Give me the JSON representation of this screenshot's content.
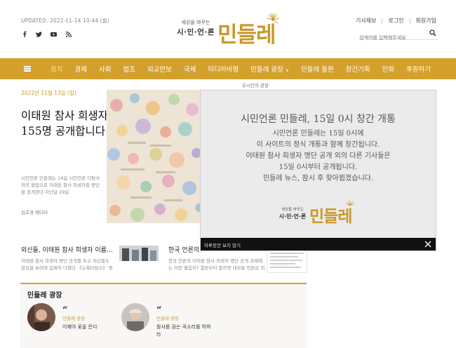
{
  "header": {
    "updated": "UPDATED. 2022-11-14 10:44 (월)",
    "socials": [
      "facebook-icon",
      "twitter-icon",
      "youtube-icon",
      "rss-icon"
    ],
    "logo_sub": "세상을 바꾸는",
    "logo_main": "시·민·언·론",
    "logo_name": "민들레",
    "links": [
      "기사제보",
      "로그인",
      "회원가입"
    ],
    "search_placeholder": "검색어를 입력해주세요"
  },
  "nav": {
    "items": [
      "정치",
      "경제",
      "사회",
      "법조",
      "외교안보",
      "국제",
      "미디어비평",
      "민들레 광장",
      "민들레 들판",
      "창간기획",
      "만화",
      "후원하기"
    ],
    "active_index": 0,
    "sub_label": "유시민의 관찰"
  },
  "main": {
    "date": "2022년 11월 13일 (일)",
    "headline": "이태원 참사 희생자 명단 155명 공개합니다",
    "lead": "시민언론 민들레는 14일 시민언론 더탐사와의 협업으로 이태원 참사 희생자들 명단을 공개한다 지난달 29일",
    "author": "김호경 에디터"
  },
  "secondary": [
    {
      "title": "외신들, 이태원 참사 희생자 이름…",
      "text": "이태원 참사 희생자 명단 공개를 두고 외신들도 관심을 보이며 일제히 다뤘다 《뉴욕타임스》 등 외"
    },
    {
      "title": "한국 언론의 ",
      "text": "한국 언론의 이태원 참사 희생자 명단 공개 과제에는 어떤 물음이? 결론부터 말하면 대부분 언론은 희생자들의"
    }
  ],
  "plaza": {
    "title": "민들레 광장",
    "cards": [
      {
        "category": "민들레 광장",
        "text": "이제야 꽃을 든다"
      },
      {
        "category": "민들레 광장",
        "text": "참사를 끊는 곡소리를 허하라"
      }
    ]
  },
  "modal": {
    "title": "시민언론 민들레, 15일 0시 창간 개통",
    "lines": [
      "시민언론 민들레는 15일 0시에",
      "이 사이트의 정식 개통과 함께 창간됩니다.",
      "이태원 참사 희생자 명단 공개 외의 다른 기사들은",
      "15일 0시부터 공개됩니다.",
      "민들레 뉴스, 잠시 후 찾아뵙겠습니다."
    ],
    "dismiss_label": "하루동안 보지 않기"
  },
  "colors": {
    "brand": "#d4a02c",
    "logo": "#c8982b"
  }
}
